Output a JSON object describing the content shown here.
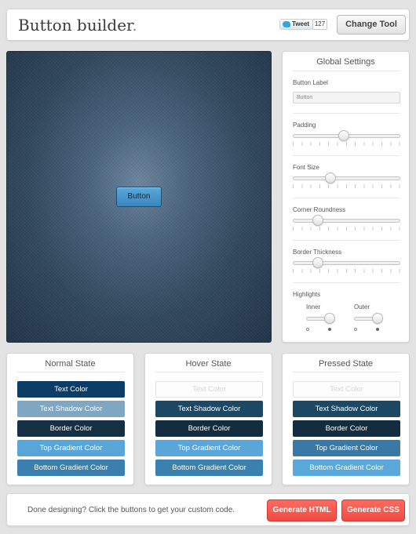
{
  "header": {
    "title": "Button builder",
    "title_dot": ".",
    "tweet_label": "Tweet",
    "tweet_count": "127",
    "change_tool_label": "Change Tool"
  },
  "preview": {
    "button_label": "Button"
  },
  "settings": {
    "title": "Global Settings",
    "button_label_label": "Button Label",
    "button_label_value": "Button",
    "padding": {
      "label": "Padding",
      "value_fraction": 0.47
    },
    "font_size": {
      "label": "Font Size",
      "value_fraction": 0.33
    },
    "corner_roundness": {
      "label": "Corner Roundness",
      "value_fraction": 0.2
    },
    "border_thickness": {
      "label": "Border Thickness",
      "value_fraction": 0.2
    },
    "highlights": {
      "label": "Highlights",
      "inner_label": "Inner",
      "outer_label": "Outer",
      "inner_on": true,
      "outer_on": true
    }
  },
  "states": {
    "normal": {
      "title": "Normal State",
      "text_color": "Text Color",
      "text_shadow_color": "Text Shadow Color",
      "border_color": "Border Color",
      "top_gradient_color": "Top Gradient Color",
      "bottom_gradient_color": "Bottom Gradient Color",
      "colors": [
        "#0c3d66",
        "#7fa7c2",
        "#152f43",
        "#58a6d8",
        "#3a7fad"
      ]
    },
    "hover": {
      "title": "Hover State",
      "text_color": "Text Color",
      "text_shadow_color": "Text Shadow Color",
      "border_color": "Border Color",
      "top_gradient_color": "Top Gradient Color",
      "bottom_gradient_color": "Bottom Gradient Color",
      "colors": [
        "#ffffff",
        "#1c4864",
        "#132c40",
        "#5aa6d8",
        "#3b81b0"
      ]
    },
    "pressed": {
      "title": "Pressed State",
      "text_color": "Text Color",
      "text_shadow_color": "Text Shadow Color",
      "border_color": "Border Color",
      "top_gradient_color": "Top Gradient Color",
      "bottom_gradient_color": "Bottom Gradient Color",
      "colors": [
        "#ffffff",
        "#1c4864",
        "#132c40",
        "#3a78a6",
        "#5aa8dc"
      ]
    }
  },
  "footer": {
    "message": "Done designing? Click the buttons to get your custom code.",
    "generate_html_label": "Generate HTML",
    "generate_css_label": "Generate CSS"
  }
}
